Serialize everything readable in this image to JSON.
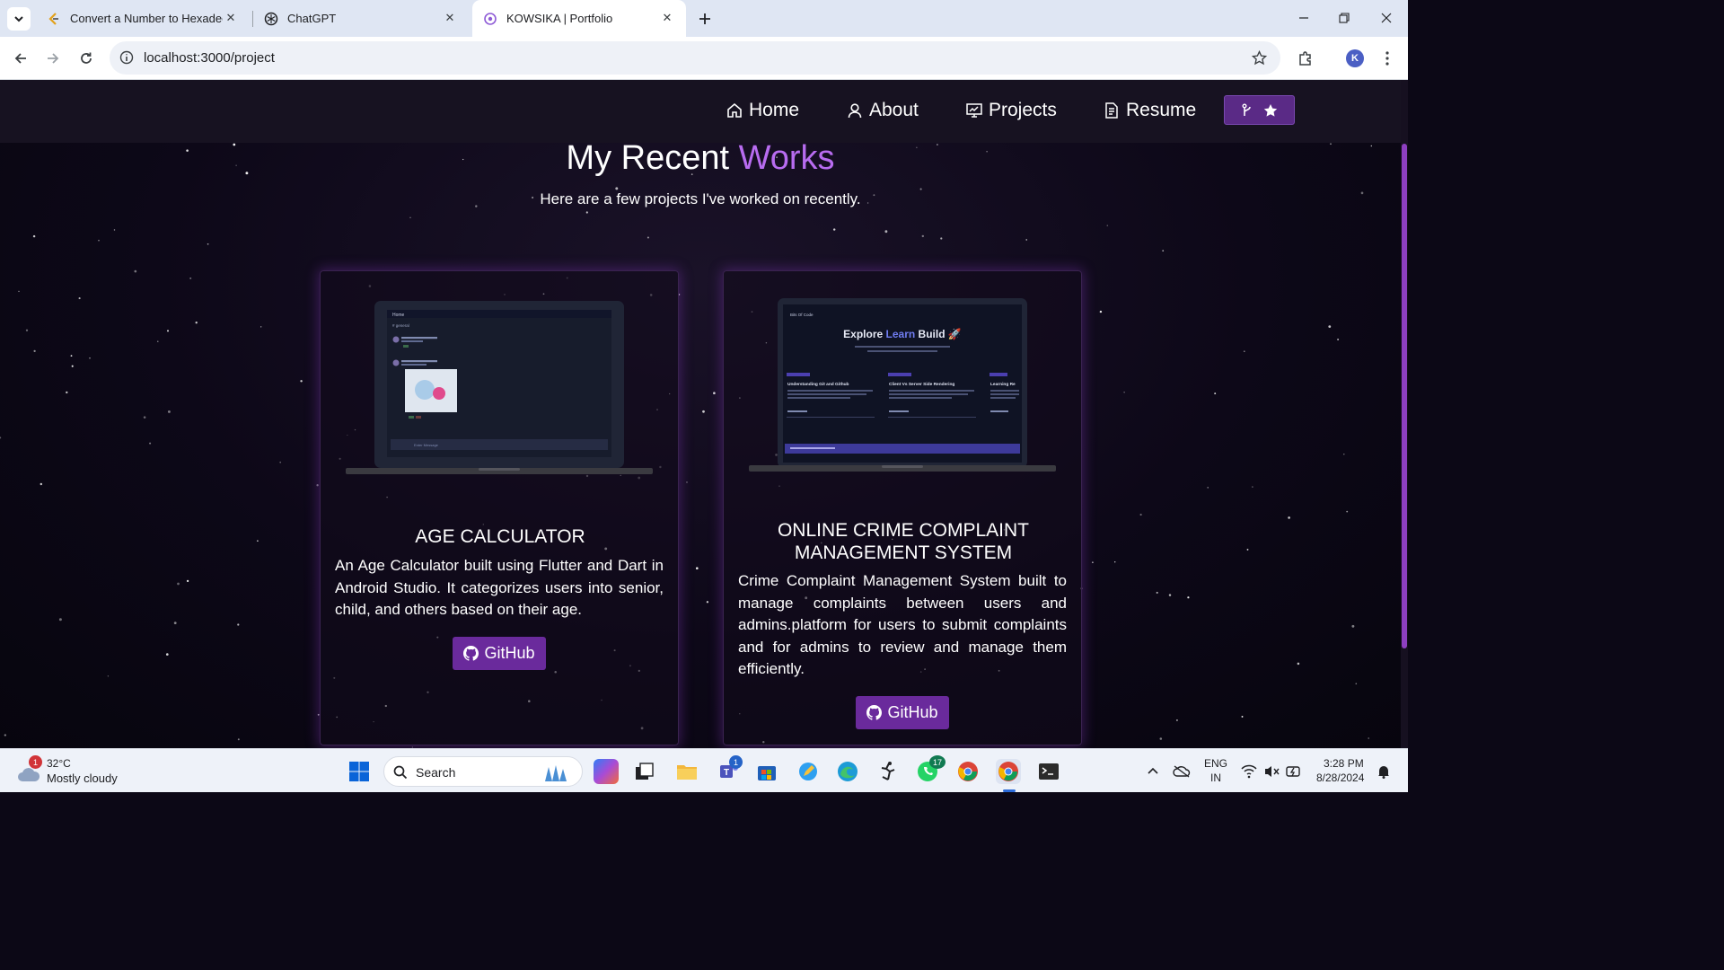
{
  "browser": {
    "tabs": [
      {
        "title": "Convert a Number to Hexadeci",
        "icon": "leetcode-favicon",
        "active": false
      },
      {
        "title": "ChatGPT",
        "icon": "chatgpt-favicon",
        "active": false
      },
      {
        "title": "KOWSIKA | Portfolio",
        "icon": "portfolio-favicon",
        "active": true
      }
    ],
    "url": "localhost:3000/project",
    "profile_initial": "K"
  },
  "site": {
    "nav": [
      {
        "label": "Home",
        "icon": "home-icon"
      },
      {
        "label": "About",
        "icon": "user-icon"
      },
      {
        "label": "Projects",
        "icon": "projects-icon"
      },
      {
        "label": "Resume",
        "icon": "resume-icon"
      }
    ],
    "accent_color": "#b86cf0",
    "button_color": "#6a2a9c",
    "heading_plain": "My Recent ",
    "heading_accent": "Works",
    "subheading": "Here are a few projects I've worked on recently.",
    "projects": [
      {
        "title": "AGE CALCULATOR",
        "description": "An Age Calculator built using Flutter and Dart in Android Studio. It categorizes users into senior, child, and others based on their age.",
        "button_label": "GitHub",
        "screenshot": {
          "header": "Home",
          "channel": "# general",
          "input_placeholder": "Enter Message"
        }
      },
      {
        "title": "ONLINE CRIME COMPLAINT MANAGEMENT SYSTEM",
        "description": "Crime Complaint Management System built to manage complaints between users and admins.platform for users to submit complaints and for admins to review and manage them efficiently.",
        "button_label": "GitHub",
        "screenshot": {
          "brand": "Bits Of Code",
          "hero_1": "Explore ",
          "hero_2": "Learn",
          "hero_3": " Build 🚀",
          "posts": [
            "Understanding Git and Github",
            "Client Vs Server Side Rendering",
            "Learning Re"
          ]
        }
      }
    ]
  },
  "taskbar": {
    "weather_temp": "32°C",
    "weather_desc": "Mostly cloudy",
    "weather_badge": "1",
    "search_placeholder": "Search",
    "teams_badge": "1",
    "whatsapp_badge": "17",
    "language": "ENG",
    "region": "IN",
    "time": "3:28 PM",
    "date": "8/28/2024"
  }
}
